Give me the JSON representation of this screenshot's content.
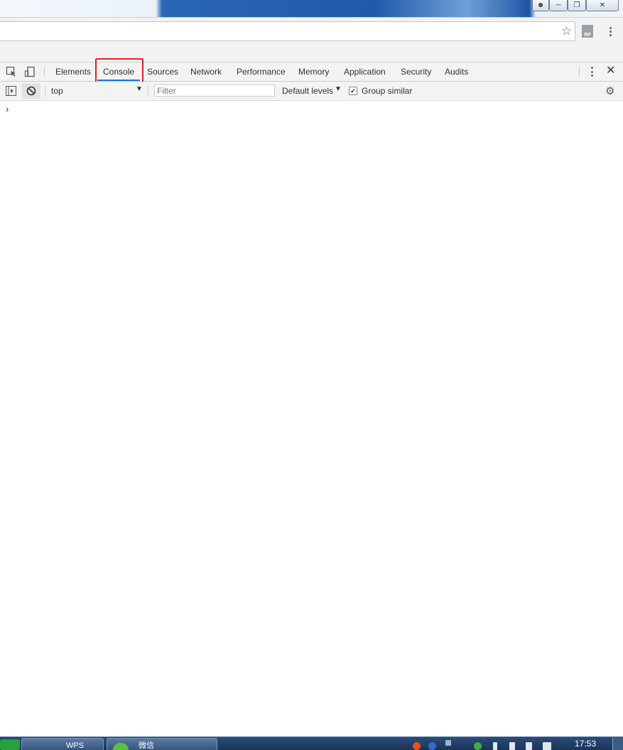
{
  "devtools": {
    "tabs": [
      "Elements",
      "Console",
      "Sources",
      "Network",
      "Performance",
      "Memory",
      "Application",
      "Security",
      "Audits"
    ],
    "active_tab": "Console"
  },
  "console_toolbar": {
    "context": "top",
    "filter_placeholder": "Filter",
    "levels": "Default levels",
    "group_similar_label": "Group similar",
    "group_similar_checked": true
  },
  "console": {
    "prompt": "›"
  },
  "taskbar": {
    "items": [
      "WPS",
      "微信"
    ],
    "clock": "17:53"
  },
  "icons": {
    "star": "star-icon",
    "extension": "rp-extension-icon",
    "menu": "more-vert-icon",
    "inspect": "inspect-element-icon",
    "device": "device-toggle-icon",
    "close": "close-icon",
    "sidebar": "console-sidebar-icon",
    "clear": "clear-console-icon",
    "settings": "gear-icon"
  },
  "colors": {
    "accent": "#1a73e8",
    "highlight": "#e52222"
  }
}
